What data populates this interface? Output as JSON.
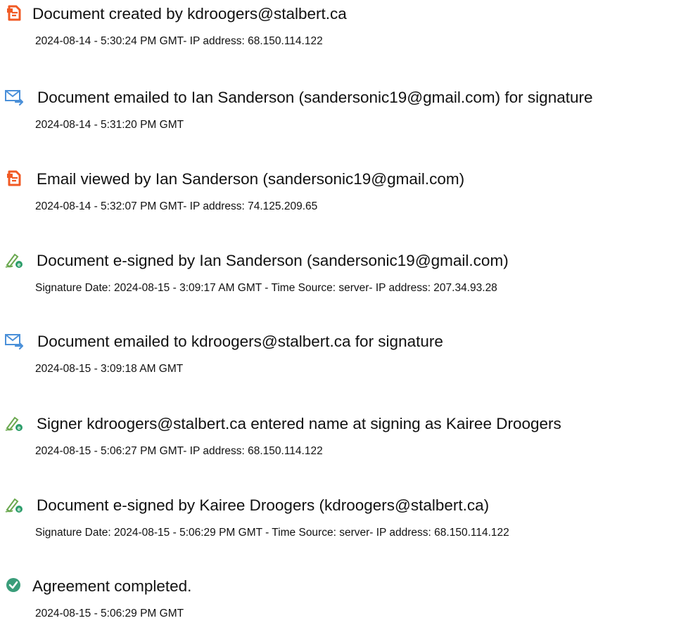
{
  "events": [
    {
      "icon": "document-created-icon",
      "title": "Document created by kdroogers@stalbert.ca",
      "detail": "2024-08-14 - 5:30:24 PM GMT- IP address: 68.150.114.122"
    },
    {
      "icon": "email-sent-icon",
      "title": "Document emailed to Ian Sanderson (sandersonic19@gmail.com) for signature",
      "detail": "2024-08-14 - 5:31:20 PM GMT"
    },
    {
      "icon": "document-viewed-icon",
      "title": "Email viewed by Ian Sanderson (sandersonic19@gmail.com)",
      "detail": "2024-08-14 - 5:32:07 PM GMT- IP address: 74.125.209.65"
    },
    {
      "icon": "esign-pen-icon",
      "title": "Document e-signed by Ian Sanderson (sandersonic19@gmail.com)",
      "detail": "Signature Date: 2024-08-15 - 3:09:17 AM GMT - Time Source: server- IP address: 207.34.93.28"
    },
    {
      "icon": "email-sent-icon",
      "title": "Document emailed to kdroogers@stalbert.ca for signature",
      "detail": "2024-08-15 - 3:09:18 AM GMT"
    },
    {
      "icon": "esign-pen-icon",
      "title": "Signer kdroogers@stalbert.ca entered name at signing as Kairee Droogers",
      "detail": "2024-08-15 - 5:06:27 PM GMT- IP address: 68.150.114.122"
    },
    {
      "icon": "esign-pen-icon",
      "title": "Document e-signed by Kairee Droogers (kdroogers@stalbert.ca)",
      "detail": "Signature Date: 2024-08-15 - 5:06:29 PM GMT - Time Source: server- IP address: 68.150.114.122"
    },
    {
      "icon": "checkmark-circle-icon",
      "title": "Agreement completed.",
      "detail": "2024-08-15 - 5:06:29 PM GMT"
    }
  ],
  "colors": {
    "document_icon": "#f15a24",
    "email_icon": "#4a90d9",
    "pen_icon": "#6aa84f",
    "complete_icon": "#3a9d7a"
  }
}
